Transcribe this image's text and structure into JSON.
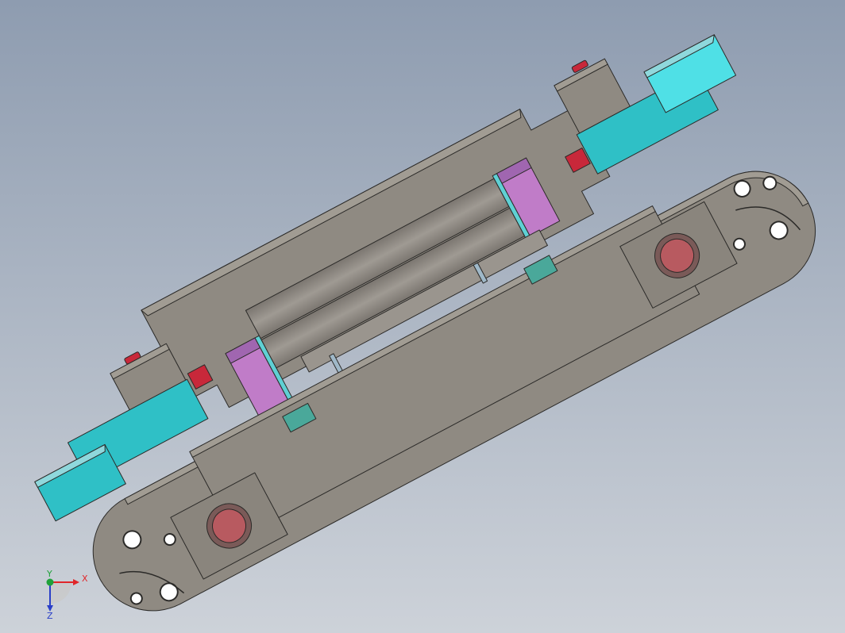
{
  "viewport": {
    "background_top": "#8e9cb0",
    "background_bottom": "#cdd2d9"
  },
  "palette": {
    "body": "#8f8a82",
    "body_light": "#a19c93",
    "body_dark": "#6f6a63",
    "edge": "#2b2a28",
    "cyan": "#2fc0c6",
    "cyan_light": "#4fe0e6",
    "magenta": "#c07cc8",
    "magenta_dark": "#a066b0",
    "red": "#c8283a",
    "button": "#b85a60",
    "button_ring": "#7a5a58",
    "teal": "#4aa89a",
    "rod": "#8b8680",
    "rod_light": "#9a958e"
  },
  "triad": {
    "x_label": "X",
    "y_label": "Y",
    "z_label": "Z",
    "x_color": "#e0262a",
    "y_color": "#1fa23a",
    "z_color": "#2a3fc8"
  }
}
